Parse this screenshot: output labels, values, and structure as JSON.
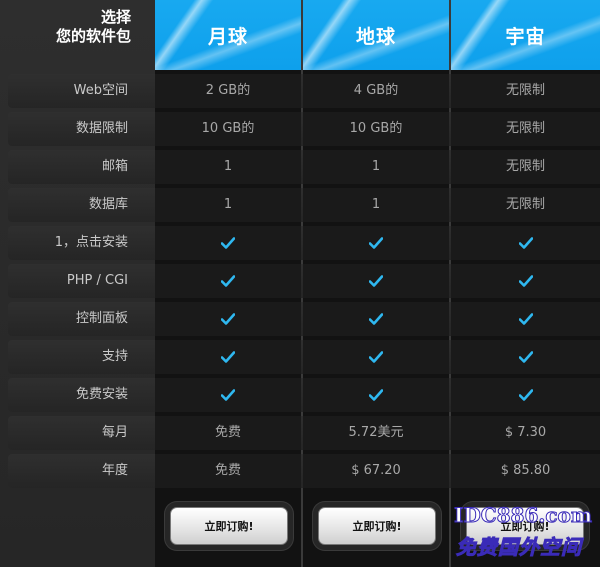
{
  "choose": {
    "line1": "选择",
    "line2": "您的软件包"
  },
  "plans": [
    {
      "name": "月球"
    },
    {
      "name": "地球"
    },
    {
      "name": "宇宙"
    }
  ],
  "rows": [
    {
      "feature": "Web空间",
      "values": [
        "2 GB的",
        "4 GB的",
        "无限制"
      ]
    },
    {
      "feature": "数据限制",
      "values": [
        "10 GB的",
        "10 GB的",
        "无限制"
      ]
    },
    {
      "feature": "邮箱",
      "values": [
        "1",
        "1",
        "无限制"
      ]
    },
    {
      "feature": "数据库",
      "values": [
        "1",
        "1",
        "无限制"
      ]
    },
    {
      "feature": "1，点击安装",
      "values": [
        "check",
        "check",
        "check"
      ]
    },
    {
      "feature": "PHP / CGI",
      "values": [
        "check",
        "check",
        "check"
      ]
    },
    {
      "feature": "控制面板",
      "values": [
        "check",
        "check",
        "check"
      ]
    },
    {
      "feature": "支持",
      "values": [
        "check",
        "check",
        "check"
      ]
    },
    {
      "feature": "免费安装",
      "values": [
        "check",
        "check",
        "check"
      ]
    },
    {
      "feature": "每月",
      "values": [
        "免费",
        "5.72美元",
        "$ 7.30"
      ]
    },
    {
      "feature": "年度",
      "values": [
        "免费",
        "$ 67.20",
        "$ 85.80"
      ]
    }
  ],
  "order_button_label": "立即订购!",
  "watermark": {
    "line1": "IDC886.com",
    "line2": "免费国外空间"
  },
  "colors": {
    "header_blue": "#12a5ee",
    "check_blue": "#2fb8f0",
    "background": "#1e1e1e"
  }
}
